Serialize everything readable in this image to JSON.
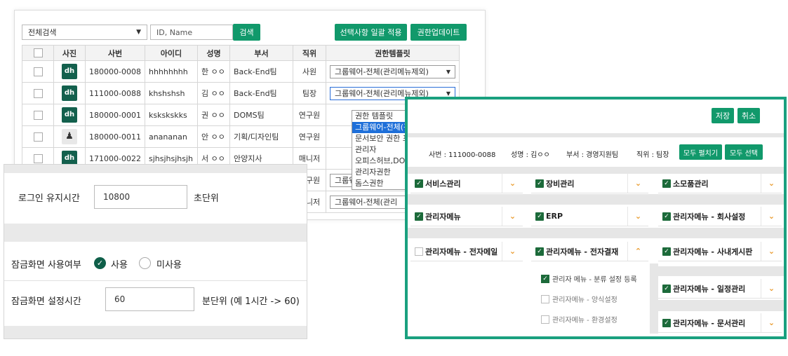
{
  "user_panel": {
    "filter_select": "전체검색",
    "search_placeholder": "ID, Name",
    "search_button": "검색",
    "apply_button": "선택사항 일괄 적용",
    "update_button": "권한업데이트",
    "columns": [
      "사진",
      "사번",
      "아이디",
      "성명",
      "부서",
      "직위",
      "권한템플릿"
    ],
    "rows": [
      {
        "photo": "dh",
        "emp_no": "180000-0008",
        "id": "hhhhhhhh",
        "name": "한 ㅇㅇ",
        "dept": "Back-End팀",
        "position": "사원",
        "template": "그룹웨어-전체(관리메뉴제외)"
      },
      {
        "photo": "dh",
        "emp_no": "111000-0088",
        "id": "khshshsh",
        "name": "김 ㅇㅇ",
        "dept": "Back-End팀",
        "position": "팀장",
        "template": "그룹웨어-전체(관리메뉴제외)"
      },
      {
        "photo": "dh",
        "emp_no": "180000-0001",
        "id": "kskskskks",
        "name": "권 ㅇㅇ",
        "dept": "DOMS팀",
        "position": "연구원",
        "template": ""
      },
      {
        "photo": "img",
        "emp_no": "180000-0011",
        "id": "anananan",
        "name": "안 ㅇㅇ",
        "dept": "기획/디자인팀",
        "position": "연구원",
        "template": ""
      },
      {
        "photo": "dh",
        "emp_no": "171000-0022",
        "id": "sjhsjhsjhsjh",
        "name": "서 ㅇㅇ",
        "dept": "안양지사",
        "position": "매니저",
        "template": ""
      },
      {
        "photo": "",
        "emp_no": "",
        "id": "",
        "name": "",
        "dept": "",
        "position": "연구원",
        "template": "그룹웨어-전체(관리"
      },
      {
        "photo": "",
        "emp_no": "",
        "id": "",
        "name": "",
        "dept": "",
        "position": "매니저",
        "template": "그룹웨어-전체(관리"
      }
    ],
    "dropdown_options": [
      "권한 템플릿",
      "그룹웨어-전체(관리",
      "문서보안 권한 포함",
      "관리자",
      "오피스허브,DOMS,",
      "관리자권한",
      "돔스권한"
    ]
  },
  "session_panel": {
    "login_keep_label": "로그인 유지시간",
    "login_keep_value": "10800",
    "login_keep_unit": "초단위",
    "lock_use_label": "잠금화면 사용여부",
    "radio_use": "사용",
    "radio_unuse": "미사용",
    "lock_time_label": "잠금화면 설정시간",
    "lock_time_value": "60",
    "lock_time_unit": "분단위 (예 1시간 -> 60)"
  },
  "auth_panel": {
    "save_button": "저장",
    "cancel_button": "취소",
    "emp_no": "사번 : 111000-0088",
    "name": "성명 : 김ㅇㅇ",
    "dept": "부서 : 경영지원팀",
    "position": "직위 : 팀장",
    "expand_all_button": "모두 펼치기",
    "select_all_button": "모두 선택",
    "menus": {
      "service": "서비스관리",
      "equipment": "장비관리",
      "supplies": "소모품관리",
      "admin": "관리자메뉴",
      "erp": "ERP",
      "admin_company": "관리자메뉴 - 회사설정",
      "admin_email": "관리자메뉴 - 전자메일",
      "admin_approval": "관리자메뉴 - 전자결재",
      "admin_board": "관리자메뉴 - 사내게시판",
      "admin_schedule": "관리자메뉴 - 일정관리",
      "admin_docs": "관리자메뉴 - 문서관리"
    },
    "sub_items": [
      "관리자 메뉴 - 분류 설정 등록",
      "관리자메뉴 - 양식설정",
      "관리자메뉴 - 환경설정"
    ]
  }
}
